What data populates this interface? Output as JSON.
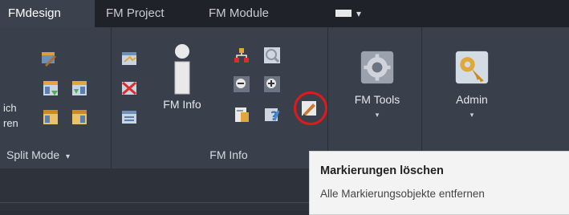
{
  "tabs": [
    {
      "label": "FMdesign",
      "active": true
    },
    {
      "label": "FM Project",
      "active": false
    },
    {
      "label": "FM Module",
      "active": false
    }
  ],
  "tab_more": {
    "caret": "▾"
  },
  "left_partial": {
    "line1": "ich",
    "line2": "ren"
  },
  "groups": {
    "split_mode": {
      "label": "Split Mode",
      "caret": "▾"
    },
    "fm_info": {
      "label": "FM Info"
    }
  },
  "buttons": {
    "fm_info": {
      "label": "FM Info",
      "icon": "info-icon"
    },
    "fm_tools": {
      "label": "FM Tools",
      "caret": "▾",
      "icon": "gear-icon"
    },
    "admin": {
      "label": "Admin",
      "caret": "▾",
      "icon": "admin-key-icon"
    }
  },
  "tooltip": {
    "title": "Markierungen löschen",
    "description": "Alle Markierungsobjekte entfernen"
  },
  "colors": {
    "accent_ring": "#e01a1a",
    "ribbon_bg": "#3a404b",
    "tab_active_bg": "#3c424d"
  }
}
